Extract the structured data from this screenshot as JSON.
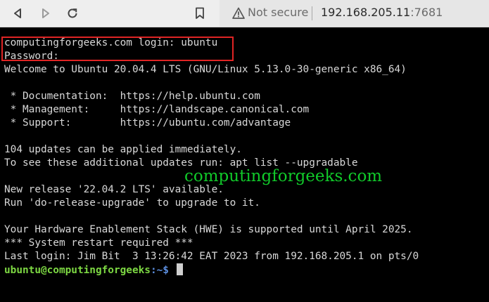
{
  "browser": {
    "not_secure_label": "Not secure",
    "url_host": "192.168.205.11",
    "url_port": ":7681",
    "icons": [
      "back-icon",
      "forward-icon",
      "reload-icon",
      "bookmark-icon",
      "warning-icon"
    ]
  },
  "terminal": {
    "lines": [
      "computingforgeeks.com login: ubuntu",
      "Password:",
      "Welcome to Ubuntu 20.04.4 LTS (GNU/Linux 5.13.0-30-generic x86_64)",
      "",
      " * Documentation:  https://help.ubuntu.com",
      " * Management:     https://landscape.canonical.com",
      " * Support:        https://ubuntu.com/advantage",
      "",
      "104 updates can be applied immediately.",
      "To see these additional updates run: apt list --upgradable",
      "",
      "New release '22.04.2 LTS' available.",
      "Run 'do-release-upgrade' to upgrade to it.",
      "",
      "Your Hardware Enablement Stack (HWE) is supported until April 2025.",
      "*** System restart required ***",
      "Last login: Jim Bit  3 13:26:42 EAT 2023 from 192.168.205.1 on pts/0"
    ],
    "prompt_user": "ubuntu@computingforgeeks",
    "prompt_path": ":~$ ",
    "colors": {
      "text": "#d8d8d8",
      "prompt_user": "#7dd843",
      "prompt_path": "#5c8fe0",
      "highlight": "#e02424",
      "watermark": "#11c92a"
    }
  },
  "watermark": "computingforgeeks.com"
}
